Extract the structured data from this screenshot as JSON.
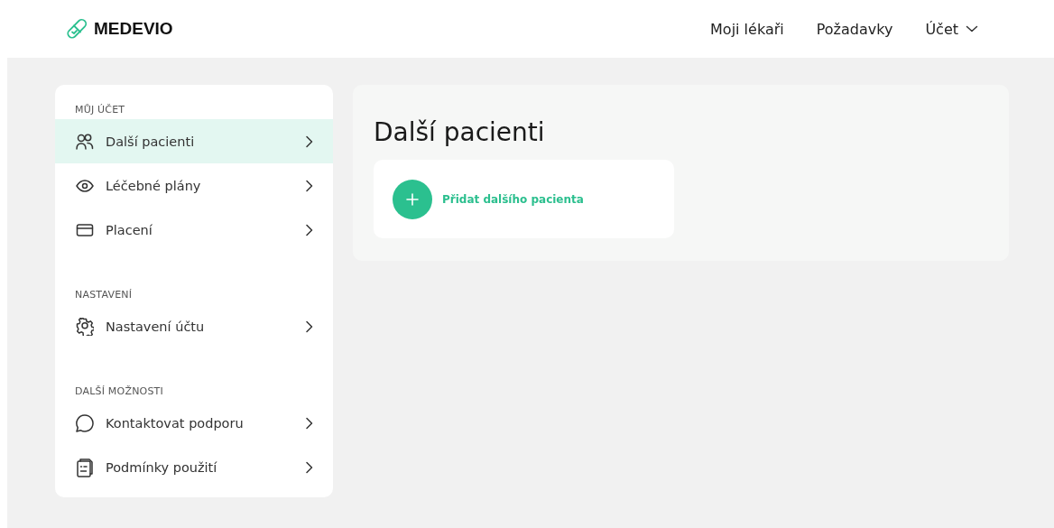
{
  "header": {
    "logo": "MEDEVIO",
    "nav": [
      {
        "label": "Moji lékaři",
        "kind": "link"
      },
      {
        "label": "Požadavky",
        "kind": "link"
      },
      {
        "label": "Účet",
        "kind": "dropdown"
      }
    ]
  },
  "sidebar": {
    "sections": [
      {
        "title": "MŮJ ÚČET",
        "items": [
          {
            "label": "Další pacienti",
            "kind": "people",
            "selected": true
          },
          {
            "label": "Léčebné plány",
            "kind": "eye",
            "selected": false
          },
          {
            "label": "Placení",
            "kind": "card",
            "selected": false
          }
        ]
      },
      {
        "title": "NASTAVENÍ",
        "items": [
          {
            "label": "Nastavení účtu",
            "kind": "gear",
            "selected": false
          }
        ]
      },
      {
        "title": "DALŠÍ MOŽNOSTI",
        "items": [
          {
            "label": "Kontaktovat podporu",
            "kind": "chat",
            "selected": false
          },
          {
            "label": "Podmínky použití",
            "kind": "document",
            "selected": false
          }
        ]
      }
    ]
  },
  "content": {
    "title": "Další pacienti",
    "add_button": {
      "label": "Přidat dalšího pacienta"
    }
  }
}
